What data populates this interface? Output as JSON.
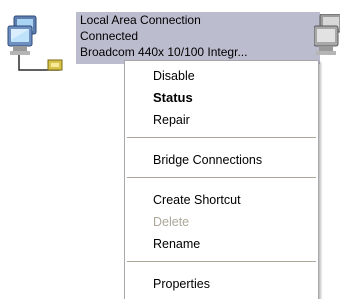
{
  "connection": {
    "name": "Local Area Connection",
    "status": "Connected",
    "device": "Broadcom 440x 10/100 Integr..."
  },
  "context_menu": {
    "items": [
      {
        "label": "Disable",
        "style": "normal"
      },
      {
        "label": "Status",
        "style": "bold-default"
      },
      {
        "label": "Repair",
        "style": "normal"
      },
      {
        "label": "Bridge Connections",
        "style": "normal"
      },
      {
        "label": "Create Shortcut",
        "style": "normal"
      },
      {
        "label": "Delete",
        "style": "disabled"
      },
      {
        "label": "Rename",
        "style": "normal"
      },
      {
        "label": "Properties",
        "style": "normal"
      }
    ]
  },
  "icons": {
    "left": "network-connection-icon",
    "right": "network-connection-icon"
  },
  "colors": {
    "selection_bg": "#bcbccf",
    "menu_border": "#a7a6aa",
    "disabled_text": "#aca899",
    "separator": "#aca899"
  }
}
